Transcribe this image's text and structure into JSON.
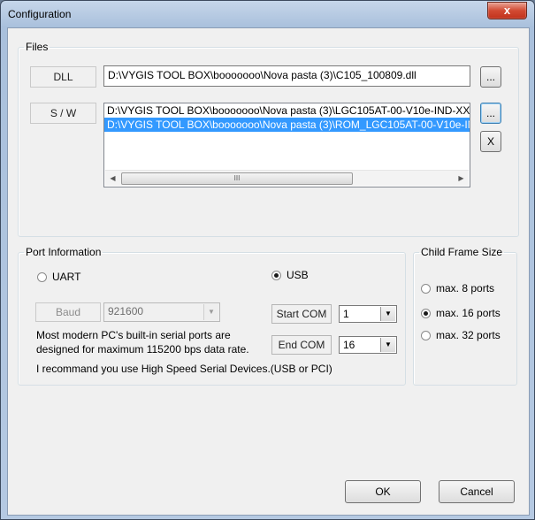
{
  "window": {
    "title": "Configuration",
    "close_glyph": "x"
  },
  "files": {
    "legend": "Files",
    "dll_label": "DLL",
    "dll_path": "D:\\VYGIS TOOL BOX\\booooooo\\Nova pasta (3)\\C105_100809.dll",
    "dll_browse": "...",
    "sw_label": "S / W",
    "sw_items": [
      "D:\\VYGIS TOOL BOX\\booooooo\\Nova pasta (3)\\LGC105AT-00-V10e-IND-XX",
      "D:\\VYGIS TOOL BOX\\booooooo\\Nova pasta (3)\\ROM_LGC105AT-00-V10e-IN"
    ],
    "sw_selected_index": 1,
    "sw_browse": "...",
    "sw_remove": "X",
    "scroll_left_glyph": "◀",
    "scroll_right_glyph": "▶",
    "scroll_grip": "III"
  },
  "port": {
    "legend": "Port Information",
    "uart_label": "UART",
    "usb_label": "USB",
    "selected": "USB",
    "baud_label": "Baud",
    "baud_value": "921600",
    "note_line1": "Most modern PC's built-in serial ports are",
    "note_line2": "designed for maximum 115200 bps data rate.",
    "start_com_label": "Start COM",
    "start_com_value": "1",
    "end_com_label": "End COM",
    "end_com_value": "16",
    "recommend": "I recommand you use High Speed Serial Devices.(USB or PCI)"
  },
  "child_frame": {
    "legend": "Child Frame Size",
    "options": [
      "max. 8 ports",
      "max. 16 ports",
      "max. 32 ports"
    ],
    "selected_index": 1
  },
  "buttons": {
    "ok": "OK",
    "cancel": "Cancel"
  },
  "icons": {
    "dropdown": "chevron-down-icon",
    "scroll_left": "arrow-left-icon",
    "scroll_right": "arrow-right-icon"
  }
}
